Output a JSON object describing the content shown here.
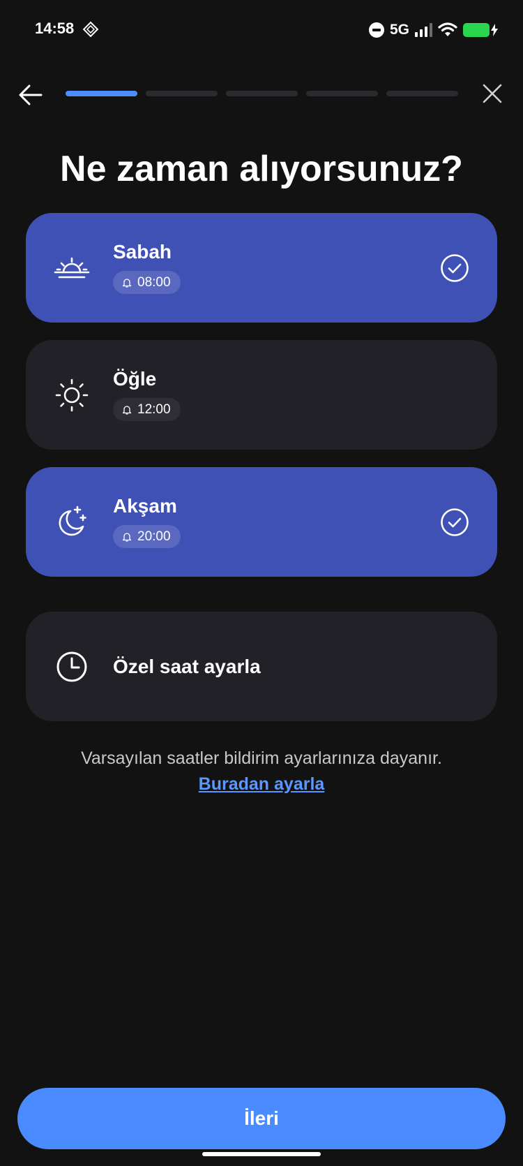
{
  "status_bar": {
    "time": "14:58",
    "network": "5G",
    "icons": [
      "app-notification-icon",
      "do-not-disturb-icon",
      "signal-icon",
      "wifi-icon",
      "battery-charging-icon"
    ]
  },
  "header": {
    "back_icon": "arrow-left-icon",
    "close_icon": "close-icon",
    "progress": {
      "total_steps": 5,
      "current_step": 1
    }
  },
  "title": "Ne zaman alıyorsunuz?",
  "options": [
    {
      "label": "Sabah",
      "time": "08:00",
      "icon": "sunrise-icon",
      "selected": true
    },
    {
      "label": "Öğle",
      "time": "12:00",
      "icon": "sun-icon",
      "selected": false
    },
    {
      "label": "Akşam",
      "time": "20:00",
      "icon": "moon-stars-icon",
      "selected": true
    }
  ],
  "custom_option": {
    "label": "Özel saat ayarla",
    "icon": "clock-icon"
  },
  "footnote": "Varsayılan saatler bildirim ayarlarınıza dayanır.",
  "settings_link": "Buradan ayarla",
  "next_button": "İleri",
  "colors": {
    "background": "#121212",
    "card": "#212127",
    "card_selected": "#3f51b5",
    "accent": "#4a8cff",
    "link": "#5c97ff"
  }
}
